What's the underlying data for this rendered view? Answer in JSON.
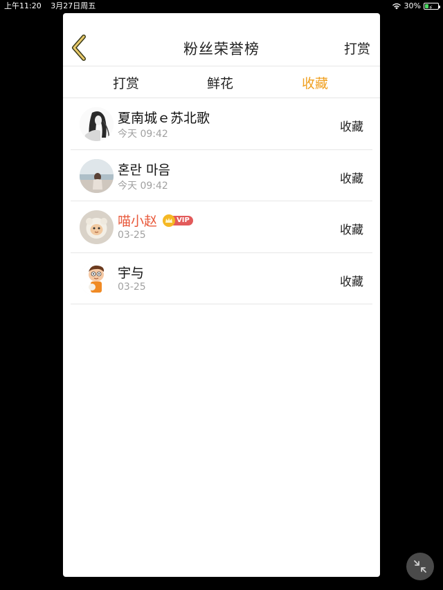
{
  "status_bar": {
    "time": "上午11:20",
    "date": "3月27日周五",
    "battery_percent": "30%",
    "battery_level": 0.3,
    "wifi_icon": "wifi-icon",
    "battery_icon": "battery-charging-icon"
  },
  "navbar": {
    "back_icon": "chevron-left-icon",
    "title": "粉丝荣誉榜",
    "action_label": "打赏"
  },
  "tabs": [
    {
      "label": "打赏",
      "active": false
    },
    {
      "label": "鲜花",
      "active": false
    },
    {
      "label": "收藏",
      "active": true
    }
  ],
  "colors": {
    "accent": "#f0a020",
    "vip_name": "#e8583a",
    "vip_badge": "#e25a5a",
    "vip_crown": "#f5b824",
    "secondary_text": "#a0a0a0"
  },
  "rows": [
    {
      "name": "夏南城ｅ苏北歌",
      "time": "今天 09:42",
      "action": "收藏",
      "avatar": "sketch-girl-avatar",
      "vip": false
    },
    {
      "name": "혼란 마음",
      "time": "今天 09:42",
      "action": "收藏",
      "avatar": "beach-girl-avatar",
      "vip": false
    },
    {
      "name": "喵小赵",
      "time": "03-25",
      "action": "收藏",
      "avatar": "cartoon-sheep-avatar",
      "vip": true,
      "vip_label": "VIP"
    },
    {
      "name": "宇与",
      "time": "03-25",
      "action": "收藏",
      "avatar": "cartoon-boy-avatar",
      "vip": false
    }
  ],
  "floating_button_icon": "collapse-arrows-icon"
}
